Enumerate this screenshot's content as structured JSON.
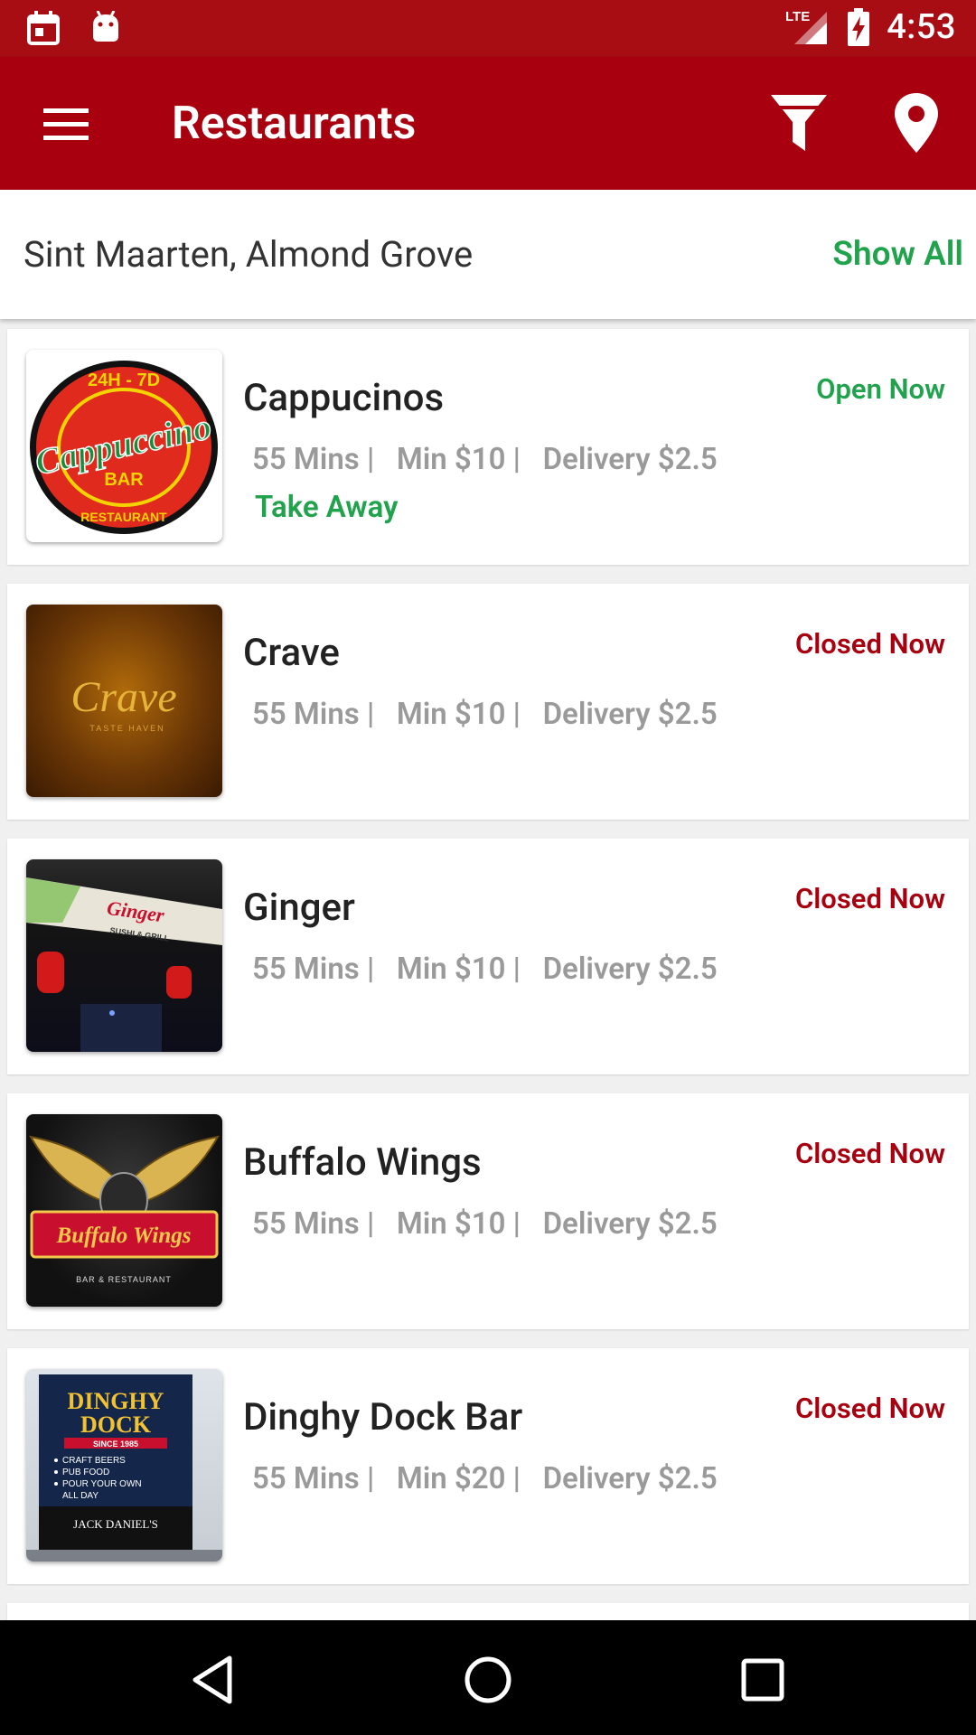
{
  "status_bar": {
    "network": "LTE",
    "time": "4:53"
  },
  "app_bar": {
    "title": "Restaurants"
  },
  "location": {
    "text": "Sint Maarten, Almond Grove",
    "show_all": "Show All"
  },
  "colors": {
    "brand_red": "#a8000f",
    "open_green": "#21a34d",
    "closed_red": "#a8000f"
  },
  "restaurants": [
    {
      "name": "Cappucinos",
      "status": "Open Now",
      "open": true,
      "time": "55 Mins |",
      "min": "Min $10 |",
      "delivery": "Delivery $2.5",
      "tag": "Take Away",
      "logo": {
        "top": "24H - 7D",
        "main": "Cappuccino",
        "sub": "BAR",
        "bottom": "RESTAURANT"
      }
    },
    {
      "name": "Crave",
      "status": "Closed Now",
      "open": false,
      "time": "55 Mins |",
      "min": "Min $10 |",
      "delivery": "Delivery $2.5",
      "logo": {
        "main": "Crave",
        "sub": "TASTE HAVEN"
      }
    },
    {
      "name": "Ginger",
      "status": "Closed Now",
      "open": false,
      "time": "55 Mins |",
      "min": "Min $10 |",
      "delivery": "Delivery $2.5",
      "logo": {
        "main": "Ginger",
        "sub": "SUSHI & GRILL"
      }
    },
    {
      "name": "Buffalo Wings",
      "status": "Closed Now",
      "open": false,
      "time": "55 Mins |",
      "min": "Min $10 |",
      "delivery": "Delivery $2.5",
      "logo": {
        "main": "Buffalo Wings",
        "sub": "BAR & RESTAURANT"
      }
    },
    {
      "name": "Dinghy Dock Bar",
      "status": "Closed Now",
      "open": false,
      "time": "55 Mins |",
      "min": "Min $20 |",
      "delivery": "Delivery $2.5",
      "logo": {
        "main1": "DINGHY",
        "main2": "DOCK",
        "since": "SINCE 1985",
        "items": [
          "CRAFT BEERS",
          "PUB FOOD",
          "POUR YOUR OWN",
          "ALL DAY"
        ],
        "brand": "JACK DANIEL'S"
      }
    }
  ]
}
